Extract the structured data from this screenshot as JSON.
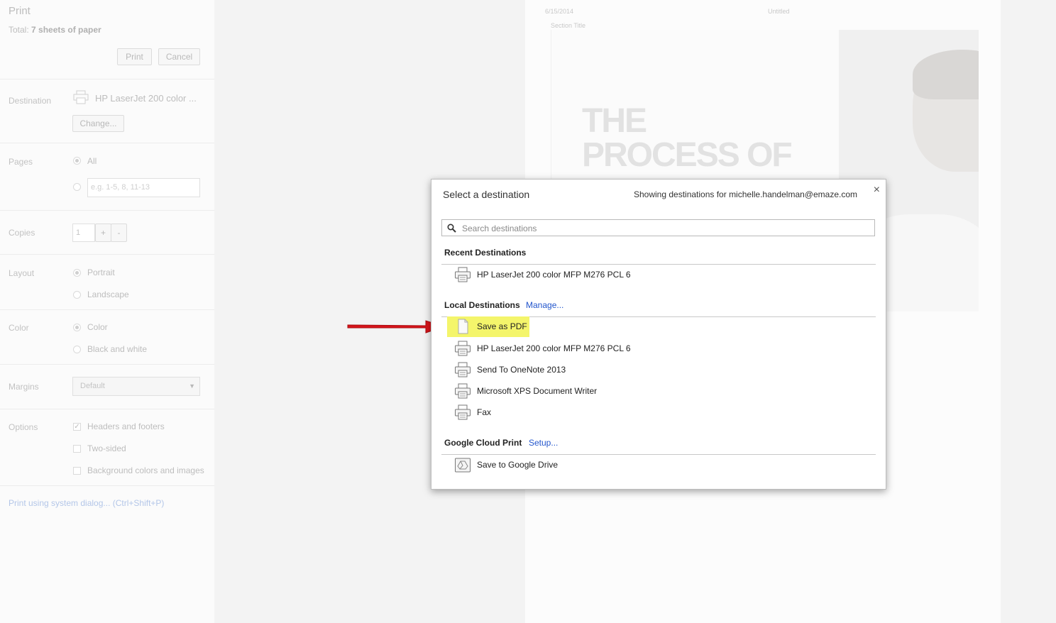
{
  "sidebar": {
    "title": "Print",
    "total_prefix": "Total: ",
    "total_value": "7 sheets of paper",
    "print_button": "Print",
    "cancel_button": "Cancel",
    "destination": {
      "label": "Destination",
      "value": "HP LaserJet 200 color ...",
      "change_button": "Change..."
    },
    "pages": {
      "label": "Pages",
      "all": "All",
      "range_placeholder": "e.g. 1-5, 8, 11-13"
    },
    "copies": {
      "label": "Copies",
      "value": "1",
      "plus": "+",
      "minus": "-"
    },
    "layout": {
      "label": "Layout",
      "portrait": "Portrait",
      "landscape": "Landscape"
    },
    "color": {
      "label": "Color",
      "color": "Color",
      "bw": "Black and white"
    },
    "margins": {
      "label": "Margins",
      "value": "Default"
    },
    "options": {
      "label": "Options",
      "headers_footers": "Headers and footers",
      "two_sided": "Two-sided",
      "background": "Background colors and images"
    },
    "system_dialog_link": "Print using system dialog... (Ctrl+Shift+P)"
  },
  "preview": {
    "date": "6/15/2014",
    "doc_title": "Untitled",
    "section_title": "Section Title",
    "hero_line1": "THE",
    "hero_line2": "PROCESS OF"
  },
  "dialog": {
    "title": "Select a destination",
    "user_info": "Showing destinations for michelle.handelman@emaze.com",
    "close": "×",
    "search_placeholder": "Search destinations",
    "recent": {
      "label": "Recent Destinations",
      "items": [
        "HP LaserJet 200 color MFP M276 PCL 6"
      ]
    },
    "local": {
      "label": "Local Destinations",
      "manage_link": "Manage...",
      "items": [
        "Save as PDF",
        "HP LaserJet 200 color MFP M276 PCL 6",
        "Send To OneNote 2013",
        "Microsoft XPS Document Writer",
        "Fax"
      ]
    },
    "cloud": {
      "label": "Google Cloud Print",
      "setup_link": "Setup...",
      "items": [
        "Save to Google Drive"
      ]
    }
  },
  "colors": {
    "highlight": "#f4f56b",
    "arrow": "#d8141a",
    "link": "#2255cc"
  }
}
